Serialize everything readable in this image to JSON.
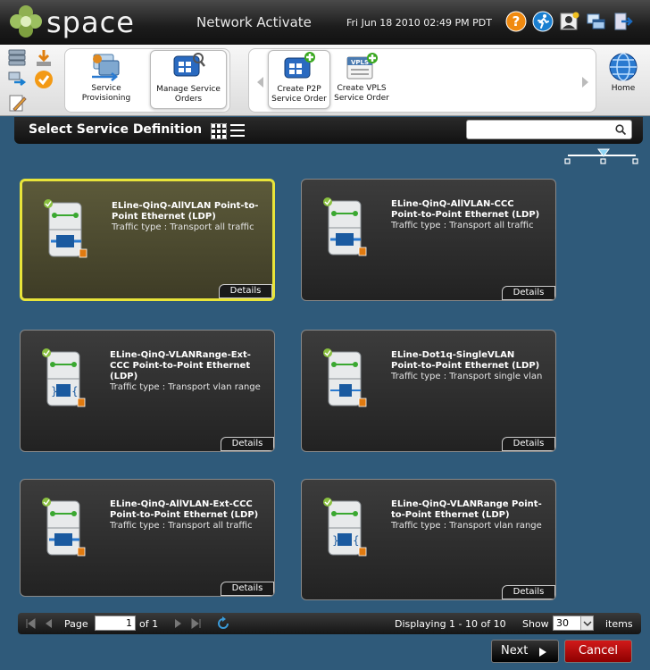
{
  "header": {
    "logo_text": "space",
    "app_title": "Network Activate",
    "datetime": "Fri Jun 18 2010 02:49 PM PDT",
    "icons": [
      "help-icon",
      "runner-icon",
      "user-icon",
      "windows-icon",
      "logout-icon"
    ],
    "help_label": "?"
  },
  "toolbar": {
    "mini_icons": [
      "server-stack-icon",
      "download-icon",
      "transfer-icon",
      "check-icon",
      "edit-icon"
    ],
    "buttons": [
      {
        "label1": "Service",
        "label2": "Provisioning"
      },
      {
        "label1": "Manage Service",
        "label2": "Orders"
      },
      {
        "label1": "Create P2P",
        "label2": "Service Order"
      },
      {
        "label1": "Create VPLS",
        "label2": "Service Order"
      }
    ],
    "vpls_badge": "VPLS",
    "home_label": "Home"
  },
  "titlebar": {
    "title": "Select Service Definition",
    "search_placeholder": ""
  },
  "cards": [
    {
      "title": "ELine-QinQ-AllVLAN Point-to-Point Ethernet (LDP)",
      "type": "Traffic type : Transport all traffic",
      "details": "Details",
      "selected": true
    },
    {
      "title": "ELine-QinQ-AllVLAN-CCC Point-to-Point Ethernet (LDP)",
      "type": "Traffic type : Transport all traffic",
      "details": "Details",
      "selected": false
    },
    {
      "title": "ELine-QinQ-VLANRange-Ext-CCC Point-to-Point Ethernet (LDP)",
      "type": "Traffic type : Transport vlan range",
      "details": "Details",
      "selected": false
    },
    {
      "title": "ELine-Dot1q-SingleVLAN Point-to-Point Ethernet (LDP)",
      "type": "Traffic type : Transport single vlan",
      "details": "Details",
      "selected": false
    },
    {
      "title": "ELine-QinQ-AllVLAN-Ext-CCC Point-to-Point Ethernet (LDP)",
      "type": "Traffic type : Transport all traffic",
      "details": "Details",
      "selected": false
    },
    {
      "title": "ELine-QinQ-VLANRange Point-to-Point Ethernet (LDP)",
      "type": "Traffic type : Transport vlan range",
      "details": "Details",
      "selected": false
    }
  ],
  "pager": {
    "page_label": "Page",
    "page_value": "1",
    "of_label": "of 1",
    "displaying": "Displaying 1 - 10 of 10",
    "show_label": "Show",
    "show_value": "30",
    "items_label": "items"
  },
  "footer": {
    "next_label": "Next",
    "cancel_label": "Cancel"
  },
  "colors": {
    "selected_border": "#e8e43a",
    "cancel_red": "#c00000",
    "accent_blue": "#1f6fc0"
  }
}
